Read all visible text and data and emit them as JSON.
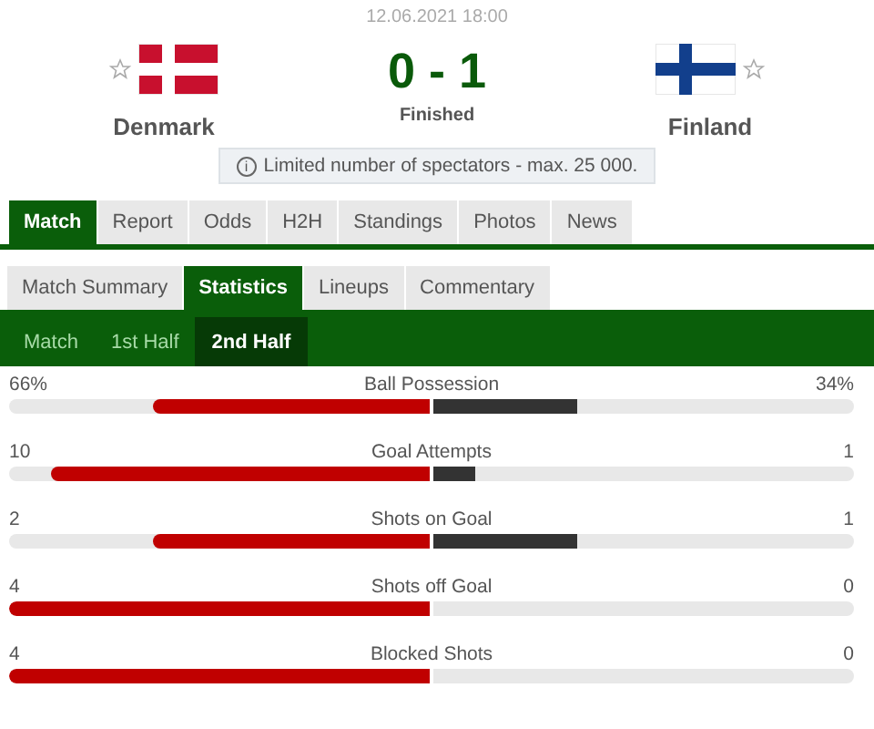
{
  "date": "12.06.2021 18:00",
  "home": {
    "name": "Denmark",
    "favorite": false
  },
  "score": "0 - 1",
  "status": "Finished",
  "away": {
    "name": "Finland",
    "favorite": false
  },
  "notice": {
    "icon": "i",
    "text": "Limited number of spectators - max. 25 000."
  },
  "tabs": [
    {
      "label": "Match",
      "selected": true
    },
    {
      "label": "Report",
      "selected": false
    },
    {
      "label": "Odds",
      "selected": false
    },
    {
      "label": "H2H",
      "selected": false
    },
    {
      "label": "Standings",
      "selected": false
    },
    {
      "label": "Photos",
      "selected": false
    },
    {
      "label": "News",
      "selected": false
    }
  ],
  "subtabs": [
    {
      "label": "Match Summary",
      "selected": false
    },
    {
      "label": "Statistics",
      "selected": true
    },
    {
      "label": "Lineups",
      "selected": false
    },
    {
      "label": "Commentary",
      "selected": false
    }
  ],
  "periods": [
    {
      "label": "Match",
      "selected": false
    },
    {
      "label": "1st Half",
      "selected": false
    },
    {
      "label": "2nd Half",
      "selected": true
    }
  ],
  "stats": [
    {
      "label": "Ball Possession",
      "home": {
        "value": "66%",
        "level": 0.66
      },
      "away": {
        "value": "34%",
        "level": 0.34
      }
    },
    {
      "label": "Goal Attempts",
      "home": {
        "value": "10",
        "level": 0.9
      },
      "away": {
        "value": "1",
        "level": 0.1
      }
    },
    {
      "label": "Shots on Goal",
      "home": {
        "value": "2",
        "level": 0.66
      },
      "away": {
        "value": "1",
        "level": 0.34
      }
    },
    {
      "label": "Shots off Goal",
      "home": {
        "value": "4",
        "level": 1
      },
      "away": {
        "value": "0",
        "level": 0
      }
    },
    {
      "label": "Blocked Shots",
      "home": {
        "value": "4",
        "level": 1
      },
      "away": {
        "value": "0",
        "level": 0
      }
    }
  ]
}
